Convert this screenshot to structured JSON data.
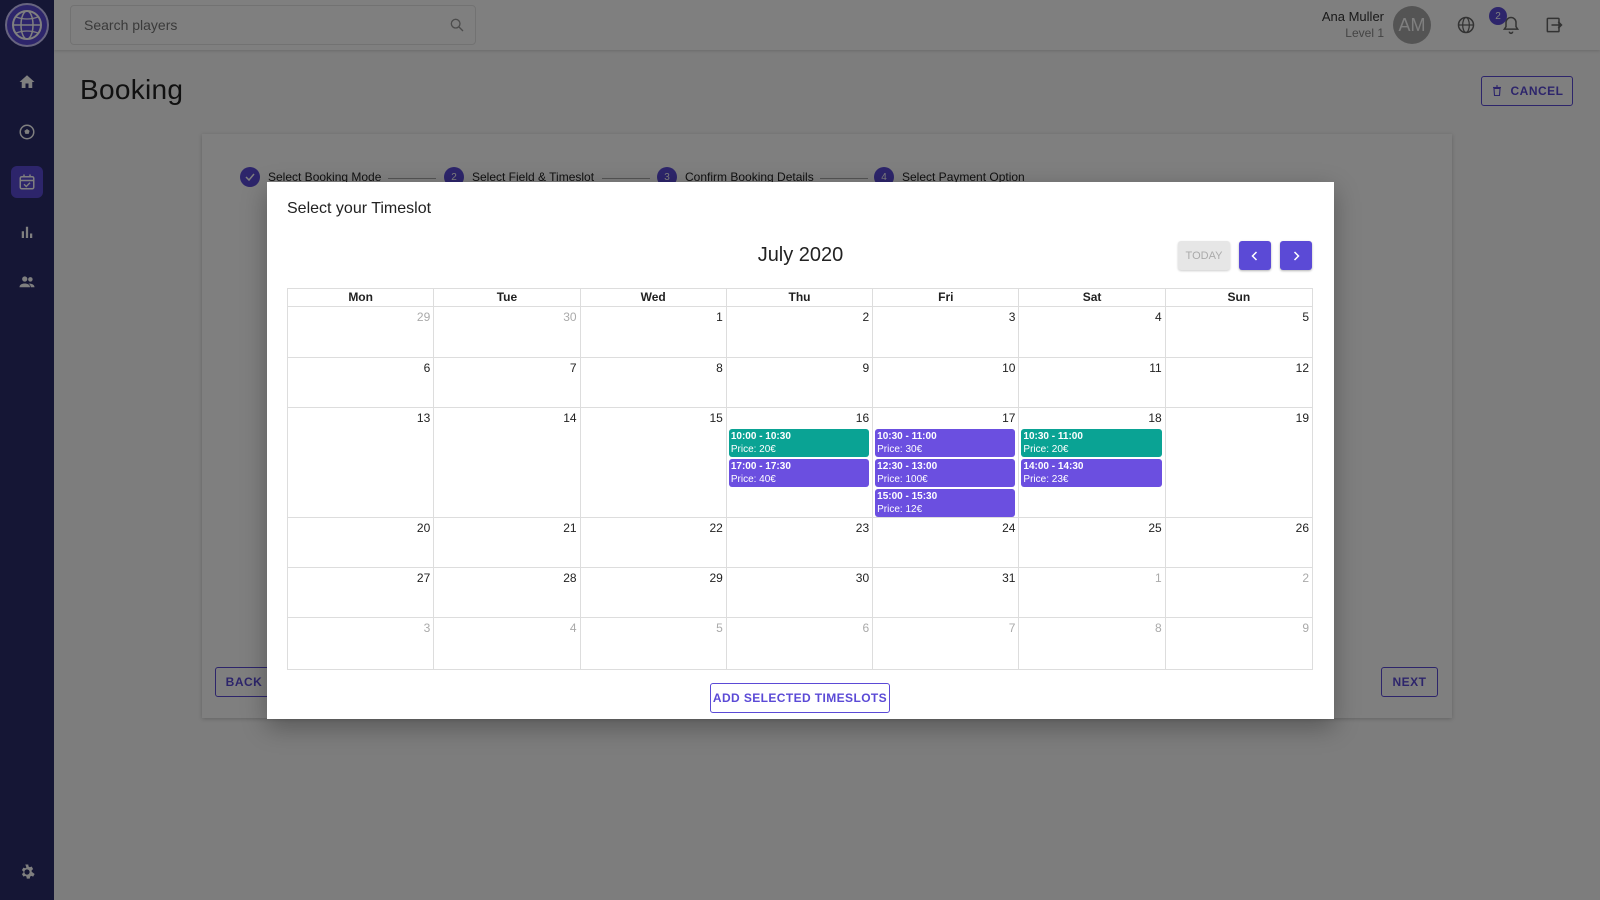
{
  "topbar": {
    "search_placeholder": "Search players",
    "user_name": "Ana Muller",
    "user_level": "Level 1",
    "avatar_initials": "AM",
    "notification_count": "2"
  },
  "sidebar": {
    "items": [
      {
        "icon": "home-icon"
      },
      {
        "icon": "soccer-ball-icon"
      },
      {
        "icon": "calendar-icon",
        "active": true
      },
      {
        "icon": "bar-chart-icon"
      },
      {
        "icon": "people-icon"
      }
    ],
    "settings_icon": "gear-icon"
  },
  "page": {
    "title": "Booking",
    "cancel_label": "CANCEL",
    "back_label": "BACK",
    "next_label": "NEXT"
  },
  "stepper": {
    "steps": [
      {
        "number": "",
        "label": "Select Booking Mode",
        "state": "done"
      },
      {
        "number": "2",
        "label": "Select Field & Timeslot",
        "state": "active"
      },
      {
        "number": "3",
        "label": "Confirm Booking Details",
        "state": "pending"
      },
      {
        "number": "4",
        "label": "Select Payment Option",
        "state": "pending"
      }
    ]
  },
  "modal": {
    "title": "Select your Timeslot",
    "month": "July 2020",
    "today_label": "TODAY",
    "add_label": "ADD SELECTED TIMESLOTS",
    "weekdays": [
      "Mon",
      "Tue",
      "Wed",
      "Thu",
      "Fri",
      "Sat",
      "Sun"
    ],
    "weeks": [
      [
        {
          "d": "29",
          "m": true
        },
        {
          "d": "30",
          "m": true
        },
        {
          "d": "1"
        },
        {
          "d": "2"
        },
        {
          "d": "3"
        },
        {
          "d": "4"
        },
        {
          "d": "5"
        }
      ],
      [
        {
          "d": "6"
        },
        {
          "d": "7"
        },
        {
          "d": "8"
        },
        {
          "d": "9"
        },
        {
          "d": "10"
        },
        {
          "d": "11"
        },
        {
          "d": "12"
        }
      ],
      [
        {
          "d": "13"
        },
        {
          "d": "14"
        },
        {
          "d": "15"
        },
        {
          "d": "16",
          "slots": [
            {
              "time": "10:00 - 10:30",
              "price": "Price: 20€",
              "color": "teal"
            },
            {
              "time": "17:00 - 17:30",
              "price": "Price: 40€",
              "color": "purple"
            }
          ]
        },
        {
          "d": "17",
          "slots": [
            {
              "time": "10:30 - 11:00",
              "price": "Price: 30€",
              "color": "purple"
            },
            {
              "time": "12:30 - 13:00",
              "price": "Price: 100€",
              "color": "purple"
            },
            {
              "time": "15:00 - 15:30",
              "price": "Price: 12€",
              "color": "purple"
            }
          ]
        },
        {
          "d": "18",
          "slots": [
            {
              "time": "10:30 - 11:00",
              "price": "Price: 20€",
              "color": "teal"
            },
            {
              "time": "14:00 - 14:30",
              "price": "Price: 23€",
              "color": "purple"
            }
          ]
        },
        {
          "d": "19"
        }
      ],
      [
        {
          "d": "20"
        },
        {
          "d": "21"
        },
        {
          "d": "22"
        },
        {
          "d": "23"
        },
        {
          "d": "24"
        },
        {
          "d": "25"
        },
        {
          "d": "26"
        }
      ],
      [
        {
          "d": "27"
        },
        {
          "d": "28"
        },
        {
          "d": "29"
        },
        {
          "d": "30"
        },
        {
          "d": "31"
        },
        {
          "d": "1",
          "m": true
        },
        {
          "d": "2",
          "m": true
        }
      ],
      [
        {
          "d": "3",
          "m": true
        },
        {
          "d": "4",
          "m": true
        },
        {
          "d": "5",
          "m": true
        },
        {
          "d": "6",
          "m": true
        },
        {
          "d": "7",
          "m": true
        },
        {
          "d": "8",
          "m": true
        },
        {
          "d": "9",
          "m": true
        }
      ]
    ]
  },
  "colors": {
    "primary": "#5b4ad6",
    "sidebar_bg": "#2a2d6a",
    "slot_teal": "#0aa394",
    "slot_purple": "#6b4fe0"
  }
}
